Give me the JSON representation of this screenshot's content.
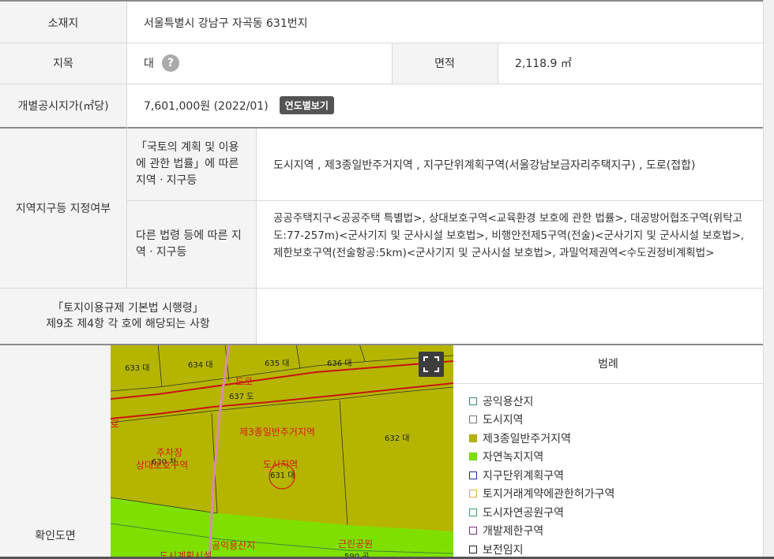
{
  "rows": {
    "location": {
      "label": "소재지",
      "value": "서울특별시 강남구 자곡동 631번지"
    },
    "jimok": {
      "label": "지목",
      "value": "대",
      "help": "?"
    },
    "area": {
      "label": "면적",
      "value": "2,118.9 ㎡"
    },
    "price": {
      "label": "개별공시지가(㎡당)",
      "value": "7,601,000원 (2022/01)",
      "button": "연도별보기"
    },
    "zoning": {
      "label": "지역지구등 지정여부",
      "sub1_label": "「국토의 계획 및 이용에 관한 법률」에 따른 지역ㆍ지구등",
      "sub1_value": "도시지역 , 제3종일반주거지역 , 지구단위계획구역(서울강남보금자리주택지구) , 도로(접합)",
      "sub2_label": "다른 법령 등에 따른 지역ㆍ지구등",
      "sub2_value": "공공주택지구<공공주택 특별법>, 상대보호구역<교육환경 보호에 관한 법률>, 대공방어협조구역(위탁고도:77-257m)<군사기지 및 군사시설 보호법>, 비행안전제5구역(전술)<군사기지 및 군사시설 보호법>, 제한보호구역(전술항공:5km)<군사기지 및 군사시설 보호법>, 과밀억제권역<수도권정비계획법>"
    },
    "regulation": {
      "label_line1": "「토지이용규제 기본법 시행령」",
      "label_line2": "제9조 제4항 각 호에 해당되는 사항",
      "value": ""
    },
    "map": {
      "label": "확인도면"
    }
  },
  "map": {
    "parcels": [
      "633 대",
      "634 대",
      "635 대",
      "636 대",
      "637 도",
      "632 대",
      "630 차",
      "631 대",
      "590 공"
    ],
    "zone_labels": [
      "도로",
      "제3종일반주거지역",
      "주차장",
      "상대보호구역",
      "도시지역",
      "공익용산지",
      "근린공원",
      "도시계획시설",
      "로"
    ],
    "fullscreen_icon": "expand-icon"
  },
  "legend": {
    "title": "범례",
    "items": [
      {
        "label": "공익용산지",
        "color": "#3a8a6e",
        "fill": "transparent"
      },
      {
        "label": "도시지역",
        "color": "#777777",
        "fill": "transparent"
      },
      {
        "label": "제3종일반주거지역",
        "color": "#a8a800",
        "fill": "#b5b500"
      },
      {
        "label": "자연녹지지역",
        "color": "#6ad400",
        "fill": "#7fe000"
      },
      {
        "label": "지구단위계획구역",
        "color": "#1f2f9c",
        "fill": "transparent"
      },
      {
        "label": "토지거래계약에관한허가구역",
        "color": "#e0b040",
        "fill": "transparent"
      },
      {
        "label": "도시자연공원구역",
        "color": "#3aa070",
        "fill": "transparent"
      },
      {
        "label": "개발제한구역",
        "color": "#7a3090",
        "fill": "transparent"
      },
      {
        "label": "보전임지",
        "color": "#222222",
        "fill": "transparent"
      }
    ]
  }
}
